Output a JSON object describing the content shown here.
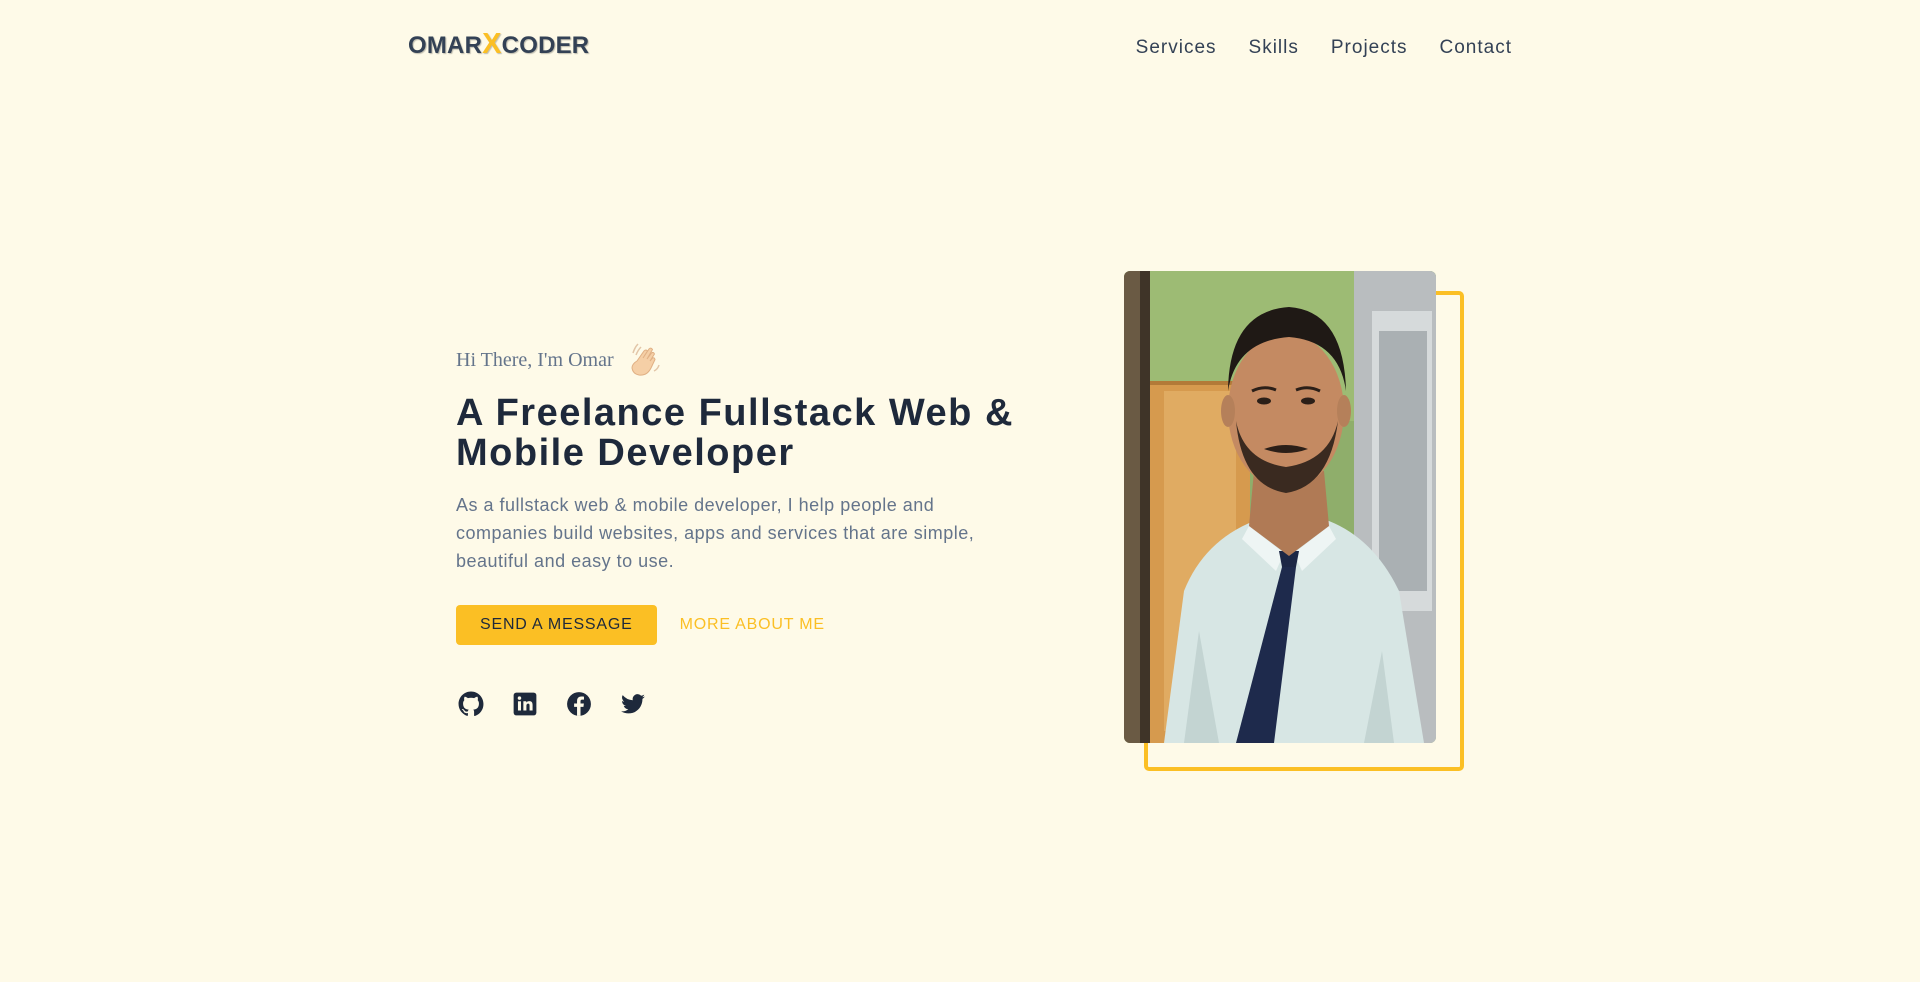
{
  "header": {
    "logo": {
      "part1": "OMAR",
      "part2": "X",
      "part3": "CODER"
    },
    "nav": [
      "Services",
      "Skills",
      "Projects",
      "Contact"
    ]
  },
  "hero": {
    "greeting": "Hi There, I'm Omar",
    "greeting_icon": "waving-hand-icon",
    "headline": "A Freelance Fullstack Web & Mobile Developer",
    "description": "As a fullstack web & mobile developer, I help people and companies build websites, apps and services that are simple, beautiful and easy to use.",
    "primary_button": "SEND A MESSAGE",
    "secondary_button": "MORE ABOUT ME",
    "socials": [
      "github-icon",
      "linkedin-icon",
      "facebook-icon",
      "twitter-icon"
    ]
  },
  "colors": {
    "background": "#fefae8",
    "accent": "#fbbf24",
    "heading": "#1e293b",
    "muted": "#64748b"
  }
}
